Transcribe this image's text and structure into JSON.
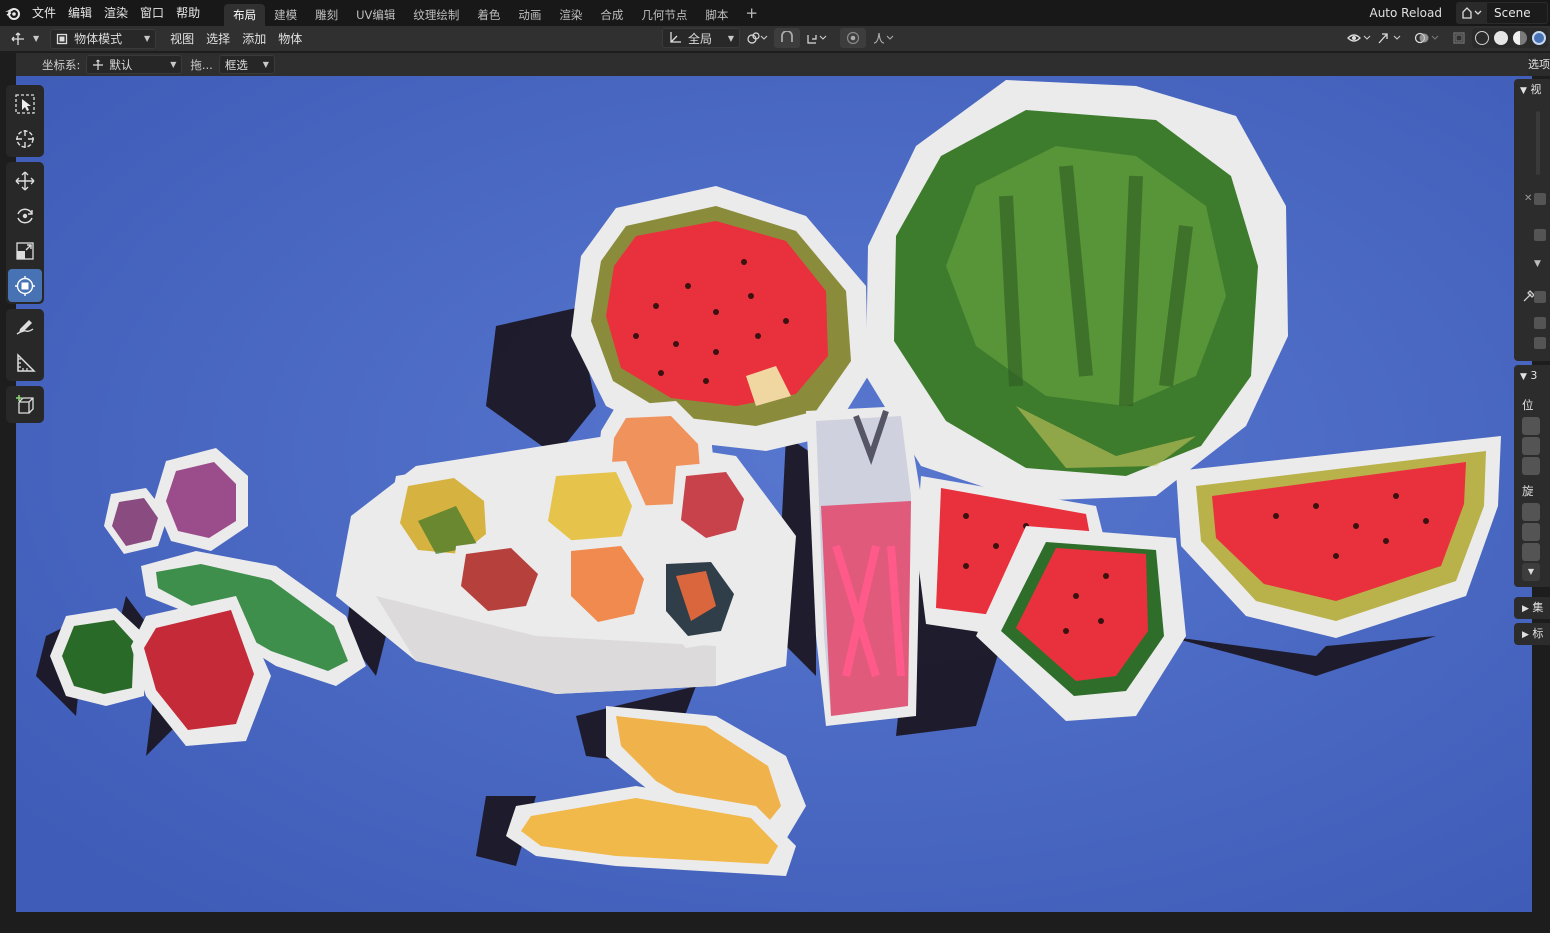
{
  "menu": {
    "items": [
      "文件",
      "编辑",
      "渲染",
      "窗口",
      "帮助"
    ]
  },
  "workspaces": {
    "tabs": [
      "布局",
      "建模",
      "雕刻",
      "UV编辑",
      "纹理绘制",
      "着色",
      "动画",
      "渲染",
      "合成",
      "几何节点",
      "脚本"
    ],
    "active": "布局",
    "add": "+"
  },
  "topright": {
    "auto_reload": "Auto Reload",
    "scene": "Scene"
  },
  "header": {
    "mode": "物体模式",
    "menus": [
      "视图",
      "选择",
      "添加",
      "物体"
    ],
    "orientation": "全局"
  },
  "toolsettings": {
    "coord_label": "坐标系:",
    "coord_value": "默认",
    "drag_label": "拖...",
    "select_mode": "框选",
    "options": "选项"
  },
  "npanel": {
    "view_title": "视",
    "transform_title": "3",
    "location_label": "位",
    "rotation_label": "旋",
    "tab_collection": "集",
    "tab_annotation": "标"
  },
  "colors": {
    "viewport_bg": "#4a6ac4",
    "accent": "#4772b3",
    "watermelon_rind": "#3f7a30",
    "watermelon_flesh": "#e7323e",
    "banana": "#f1b84a",
    "sticker_border": "#ecebeb"
  }
}
